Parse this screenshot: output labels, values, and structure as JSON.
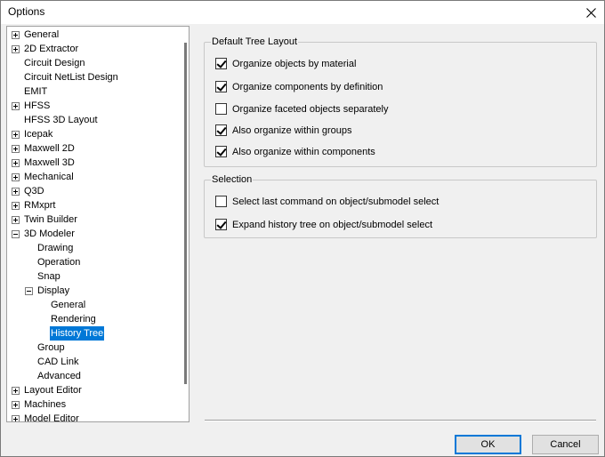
{
  "window": {
    "title": "Options",
    "close_icon": "close-icon"
  },
  "tree": {
    "items": [
      {
        "label": "General",
        "expander": "plus"
      },
      {
        "label": "2D Extractor",
        "expander": "plus"
      },
      {
        "label": "Circuit Design",
        "expander": "none"
      },
      {
        "label": "Circuit NetList Design",
        "expander": "none"
      },
      {
        "label": "EMIT",
        "expander": "none"
      },
      {
        "label": "HFSS",
        "expander": "plus"
      },
      {
        "label": "HFSS 3D Layout",
        "expander": "none"
      },
      {
        "label": "Icepak",
        "expander": "plus"
      },
      {
        "label": "Maxwell 2D",
        "expander": "plus"
      },
      {
        "label": "Maxwell 3D",
        "expander": "plus"
      },
      {
        "label": "Mechanical",
        "expander": "plus"
      },
      {
        "label": "Q3D",
        "expander": "plus"
      },
      {
        "label": "RMxprt",
        "expander": "plus"
      },
      {
        "label": "Twin Builder",
        "expander": "plus"
      },
      {
        "label": "3D Modeler",
        "expander": "minus"
      },
      {
        "label": "Drawing",
        "expander": "none"
      },
      {
        "label": "Operation",
        "expander": "none"
      },
      {
        "label": "Snap",
        "expander": "none"
      },
      {
        "label": "Display",
        "expander": "minus"
      },
      {
        "label": "General",
        "expander": "none"
      },
      {
        "label": "Rendering",
        "expander": "none"
      },
      {
        "label": "History Tree",
        "expander": "none",
        "selected": true
      },
      {
        "label": "Group",
        "expander": "none"
      },
      {
        "label": "CAD Link",
        "expander": "none"
      },
      {
        "label": "Advanced",
        "expander": "none"
      },
      {
        "label": "Layout Editor",
        "expander": "plus"
      },
      {
        "label": "Machines",
        "expander": "plus"
      },
      {
        "label": "Model Editor",
        "expander": "plus"
      }
    ]
  },
  "default_tree_layout": {
    "title": "Default Tree Layout",
    "options": [
      {
        "label": "Organize objects by material",
        "checked": true
      },
      {
        "label": "Organize components by definition",
        "checked": true
      },
      {
        "label": "Organize faceted objects separately",
        "checked": false
      },
      {
        "label": "Also organize within groups",
        "checked": true
      },
      {
        "label": "Also organize within components",
        "checked": true
      }
    ]
  },
  "selection": {
    "title": "Selection",
    "options": [
      {
        "label": "Select last command on object/submodel select",
        "checked": false
      },
      {
        "label": "Expand history tree on object/submodel select",
        "checked": true
      }
    ]
  },
  "buttons": {
    "ok": "OK",
    "cancel": "Cancel"
  },
  "colors": {
    "selection_highlight": "#0078d7",
    "dialog_background": "#f0f0f0"
  }
}
